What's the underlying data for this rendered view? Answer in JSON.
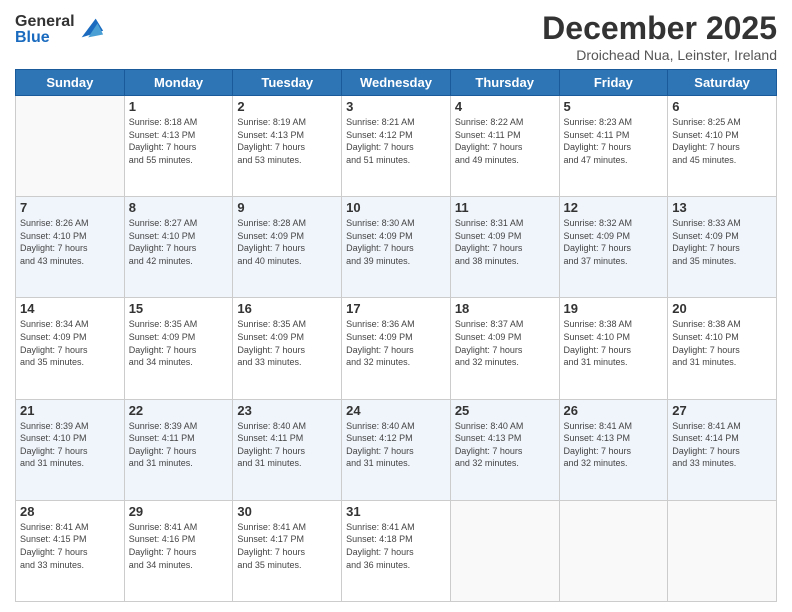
{
  "header": {
    "logo": {
      "general": "General",
      "blue": "Blue"
    },
    "title": "December 2025",
    "subtitle": "Droichead Nua, Leinster, Ireland"
  },
  "weekdays": [
    "Sunday",
    "Monday",
    "Tuesday",
    "Wednesday",
    "Thursday",
    "Friday",
    "Saturday"
  ],
  "weeks": [
    [
      {
        "day": "",
        "sunrise": "",
        "sunset": "",
        "daylight": ""
      },
      {
        "day": "1",
        "sunrise": "Sunrise: 8:18 AM",
        "sunset": "Sunset: 4:13 PM",
        "daylight": "Daylight: 7 hours and 55 minutes."
      },
      {
        "day": "2",
        "sunrise": "Sunrise: 8:19 AM",
        "sunset": "Sunset: 4:13 PM",
        "daylight": "Daylight: 7 hours and 53 minutes."
      },
      {
        "day": "3",
        "sunrise": "Sunrise: 8:21 AM",
        "sunset": "Sunset: 4:12 PM",
        "daylight": "Daylight: 7 hours and 51 minutes."
      },
      {
        "day": "4",
        "sunrise": "Sunrise: 8:22 AM",
        "sunset": "Sunset: 4:11 PM",
        "daylight": "Daylight: 7 hours and 49 minutes."
      },
      {
        "day": "5",
        "sunrise": "Sunrise: 8:23 AM",
        "sunset": "Sunset: 4:11 PM",
        "daylight": "Daylight: 7 hours and 47 minutes."
      },
      {
        "day": "6",
        "sunrise": "Sunrise: 8:25 AM",
        "sunset": "Sunset: 4:10 PM",
        "daylight": "Daylight: 7 hours and 45 minutes."
      }
    ],
    [
      {
        "day": "7",
        "sunrise": "Sunrise: 8:26 AM",
        "sunset": "Sunset: 4:10 PM",
        "daylight": "Daylight: 7 hours and 43 minutes."
      },
      {
        "day": "8",
        "sunrise": "Sunrise: 8:27 AM",
        "sunset": "Sunset: 4:10 PM",
        "daylight": "Daylight: 7 hours and 42 minutes."
      },
      {
        "day": "9",
        "sunrise": "Sunrise: 8:28 AM",
        "sunset": "Sunset: 4:09 PM",
        "daylight": "Daylight: 7 hours and 40 minutes."
      },
      {
        "day": "10",
        "sunrise": "Sunrise: 8:30 AM",
        "sunset": "Sunset: 4:09 PM",
        "daylight": "Daylight: 7 hours and 39 minutes."
      },
      {
        "day": "11",
        "sunrise": "Sunrise: 8:31 AM",
        "sunset": "Sunset: 4:09 PM",
        "daylight": "Daylight: 7 hours and 38 minutes."
      },
      {
        "day": "12",
        "sunrise": "Sunrise: 8:32 AM",
        "sunset": "Sunset: 4:09 PM",
        "daylight": "Daylight: 7 hours and 37 minutes."
      },
      {
        "day": "13",
        "sunrise": "Sunrise: 8:33 AM",
        "sunset": "Sunset: 4:09 PM",
        "daylight": "Daylight: 7 hours and 35 minutes."
      }
    ],
    [
      {
        "day": "14",
        "sunrise": "Sunrise: 8:34 AM",
        "sunset": "Sunset: 4:09 PM",
        "daylight": "Daylight: 7 hours and 35 minutes."
      },
      {
        "day": "15",
        "sunrise": "Sunrise: 8:35 AM",
        "sunset": "Sunset: 4:09 PM",
        "daylight": "Daylight: 7 hours and 34 minutes."
      },
      {
        "day": "16",
        "sunrise": "Sunrise: 8:35 AM",
        "sunset": "Sunset: 4:09 PM",
        "daylight": "Daylight: 7 hours and 33 minutes."
      },
      {
        "day": "17",
        "sunrise": "Sunrise: 8:36 AM",
        "sunset": "Sunset: 4:09 PM",
        "daylight": "Daylight: 7 hours and 32 minutes."
      },
      {
        "day": "18",
        "sunrise": "Sunrise: 8:37 AM",
        "sunset": "Sunset: 4:09 PM",
        "daylight": "Daylight: 7 hours and 32 minutes."
      },
      {
        "day": "19",
        "sunrise": "Sunrise: 8:38 AM",
        "sunset": "Sunset: 4:10 PM",
        "daylight": "Daylight: 7 hours and 31 minutes."
      },
      {
        "day": "20",
        "sunrise": "Sunrise: 8:38 AM",
        "sunset": "Sunset: 4:10 PM",
        "daylight": "Daylight: 7 hours and 31 minutes."
      }
    ],
    [
      {
        "day": "21",
        "sunrise": "Sunrise: 8:39 AM",
        "sunset": "Sunset: 4:10 PM",
        "daylight": "Daylight: 7 hours and 31 minutes."
      },
      {
        "day": "22",
        "sunrise": "Sunrise: 8:39 AM",
        "sunset": "Sunset: 4:11 PM",
        "daylight": "Daylight: 7 hours and 31 minutes."
      },
      {
        "day": "23",
        "sunrise": "Sunrise: 8:40 AM",
        "sunset": "Sunset: 4:11 PM",
        "daylight": "Daylight: 7 hours and 31 minutes."
      },
      {
        "day": "24",
        "sunrise": "Sunrise: 8:40 AM",
        "sunset": "Sunset: 4:12 PM",
        "daylight": "Daylight: 7 hours and 31 minutes."
      },
      {
        "day": "25",
        "sunrise": "Sunrise: 8:40 AM",
        "sunset": "Sunset: 4:13 PM",
        "daylight": "Daylight: 7 hours and 32 minutes."
      },
      {
        "day": "26",
        "sunrise": "Sunrise: 8:41 AM",
        "sunset": "Sunset: 4:13 PM",
        "daylight": "Daylight: 7 hours and 32 minutes."
      },
      {
        "day": "27",
        "sunrise": "Sunrise: 8:41 AM",
        "sunset": "Sunset: 4:14 PM",
        "daylight": "Daylight: 7 hours and 33 minutes."
      }
    ],
    [
      {
        "day": "28",
        "sunrise": "Sunrise: 8:41 AM",
        "sunset": "Sunset: 4:15 PM",
        "daylight": "Daylight: 7 hours and 33 minutes."
      },
      {
        "day": "29",
        "sunrise": "Sunrise: 8:41 AM",
        "sunset": "Sunset: 4:16 PM",
        "daylight": "Daylight: 7 hours and 34 minutes."
      },
      {
        "day": "30",
        "sunrise": "Sunrise: 8:41 AM",
        "sunset": "Sunset: 4:17 PM",
        "daylight": "Daylight: 7 hours and 35 minutes."
      },
      {
        "day": "31",
        "sunrise": "Sunrise: 8:41 AM",
        "sunset": "Sunset: 4:18 PM",
        "daylight": "Daylight: 7 hours and 36 minutes."
      },
      {
        "day": "",
        "sunrise": "",
        "sunset": "",
        "daylight": ""
      },
      {
        "day": "",
        "sunrise": "",
        "sunset": "",
        "daylight": ""
      },
      {
        "day": "",
        "sunrise": "",
        "sunset": "",
        "daylight": ""
      }
    ]
  ]
}
